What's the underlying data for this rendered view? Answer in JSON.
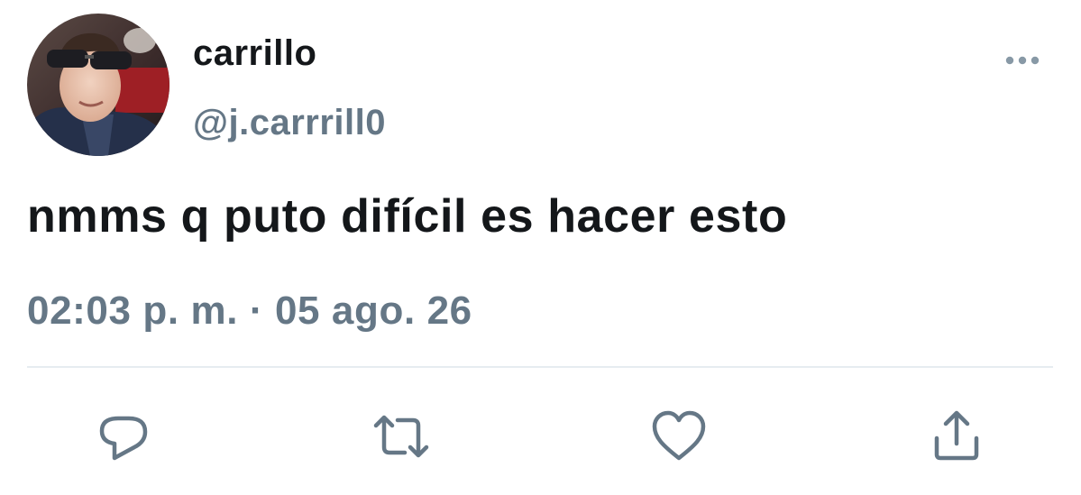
{
  "tweet": {
    "author": {
      "display_name": "carrillo",
      "handle": "@j.carrrill0",
      "avatar_icon": "avatar-photo"
    },
    "text": "nmms q puto difícil es hacer esto",
    "time": "02:03 p. m.",
    "separator": "·",
    "date": "05 ago. 26"
  },
  "actions": {
    "more_icon": "more-icon",
    "reply_icon": "reply-icon",
    "retweet_icon": "retweet-icon",
    "like_icon": "heart-icon",
    "share_icon": "share-icon"
  },
  "colors": {
    "text": "#14171a",
    "secondary": "#657786",
    "divider": "#e6ecf0",
    "background": "#ffffff"
  }
}
